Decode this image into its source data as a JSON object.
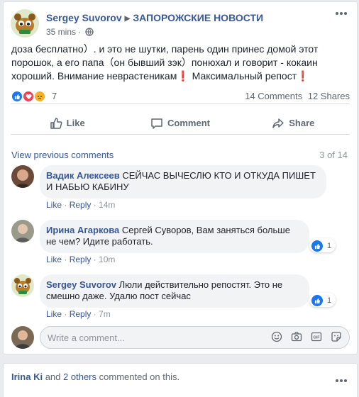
{
  "post": {
    "author": "Sergey Suvorov",
    "page": "ЗАПОРОЖСКИЕ НОВОСТИ",
    "time": "35 mins",
    "text": "доза бесплатно）. и это не шутки, парень один принес домой этот порошок, а его папа（он бывший зэк）понюхал и говорит - кокаин хороший. Внимание неврастеникам❗ Максимальный репост❗",
    "reaction_count": "7",
    "comments_count": "14 Comments",
    "shares_count": "12 Shares",
    "actions": {
      "like": "Like",
      "comment": "Comment",
      "share": "Share"
    }
  },
  "comments_section": {
    "view_previous": "View previous comments",
    "page_count": "3 of 14",
    "comments": [
      {
        "name": "Вадик Алексеев",
        "text": "СЕЙЧАС ВЫЧЕСЛЮ КТО И ОТКУДА ПИШЕТ И НАБЬЮ КАБИНУ",
        "like": "Like",
        "reply": "Reply",
        "time": "14m"
      },
      {
        "name": "Ирина Агаркова",
        "text": "Сергей Суворов, Вам заняться больше не чем? Идите работать.",
        "like": "Like",
        "reply": "Reply",
        "time": "10m",
        "reactions": "1"
      },
      {
        "name": "Sergey Suvorov",
        "text": "Люли действительно репостят. Это не смешно даже. Удалю пост сейчас",
        "like": "Like",
        "reply": "Reply",
        "time": "7m",
        "reactions": "1"
      }
    ],
    "write_placeholder": "Write a comment..."
  },
  "notification": {
    "name": "Irina Ki",
    "and": "and",
    "others": "2 others",
    "rest": "commented on this."
  },
  "colors": {
    "link": "#385898",
    "like_blue": "#1877f2",
    "bubble": "#f2f3f5"
  }
}
